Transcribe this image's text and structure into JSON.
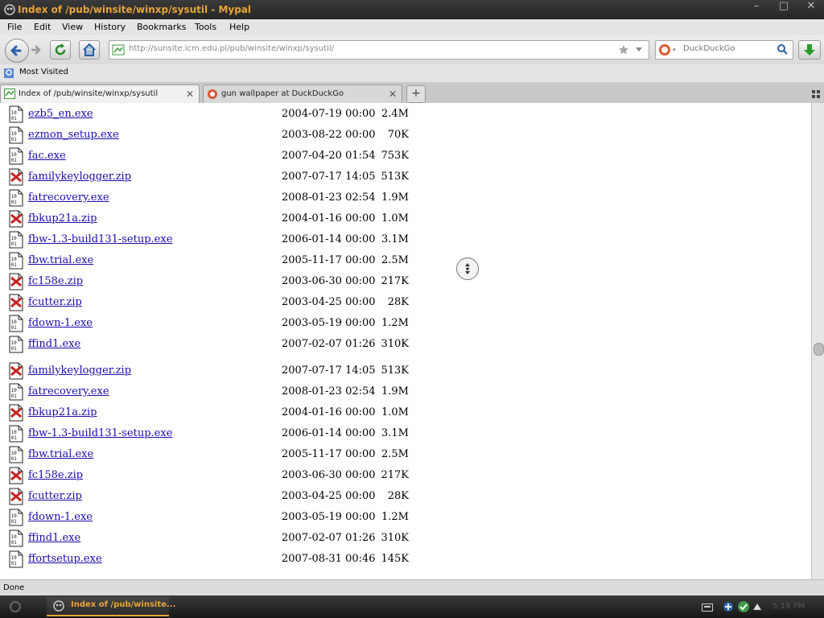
{
  "window": {
    "title": "Index of /pub/winsite/winxp/sysutil - Mypal",
    "controls": [
      "–",
      "□",
      "✕"
    ]
  },
  "menu": [
    "File",
    "Edit",
    "View",
    "History",
    "Bookmarks",
    "Tools",
    "Help"
  ],
  "nav": {
    "url": "http://sunsite.icm.edu.pl/pub/winsite/winxp/sysutil/",
    "search_placeholder": "DuckDuckGo"
  },
  "bookmarks": {
    "most_visited": "Most Visited"
  },
  "tabs": [
    {
      "label": "Index of /pub/winsite/winxp/sysutil",
      "close": "✕",
      "active": true
    },
    {
      "label": "gun wallpaper at DuckDuckGo",
      "close": "✕",
      "active": false
    }
  ],
  "tab_actions": {
    "new_tab": "+"
  },
  "files": [
    {
      "name": "ezb5_en.exe",
      "date": "2004-07-19 00:00",
      "size": "2.4M",
      "type": "exe"
    },
    {
      "name": "ezmon_setup.exe",
      "date": "2003-08-22 00:00",
      "size": "70K",
      "type": "exe"
    },
    {
      "name": "fac.exe",
      "date": "2007-04-20 01:54",
      "size": "753K",
      "type": "exe"
    },
    {
      "name": "familykeylogger.zip",
      "date": "2007-07-17 14:05",
      "size": "513K",
      "type": "zip"
    },
    {
      "name": "fatrecovery.exe",
      "date": "2008-01-23 02:54",
      "size": "1.9M",
      "type": "exe"
    },
    {
      "name": "fbkup21a.zip",
      "date": "2004-01-16 00:00",
      "size": "1.0M",
      "type": "zip"
    },
    {
      "name": "fbw-1.3-build131-setup.exe",
      "date": "2006-01-14 00:00",
      "size": "3.1M",
      "type": "exe"
    },
    {
      "name": "fbw.trial.exe",
      "date": "2005-11-17 00:00",
      "size": "2.5M",
      "type": "exe"
    },
    {
      "name": "fc158e.zip",
      "date": "2003-06-30 00:00",
      "size": "217K",
      "type": "zip"
    },
    {
      "name": "fcutter.zip",
      "date": "2003-04-25 00:00",
      "size": "28K",
      "type": "zip"
    },
    {
      "name": "fdown-1.exe",
      "date": "2003-05-19 00:00",
      "size": "1.2M",
      "type": "exe"
    },
    {
      "name": "ffind1.exe",
      "date": "2007-02-07 01:26",
      "size": "310K",
      "type": "exe"
    },
    {
      "name": "familykeylogger.zip",
      "date": "2007-07-17 14:05",
      "size": "513K",
      "type": "zip"
    },
    {
      "name": "fatrecovery.exe",
      "date": "2008-01-23 02:54",
      "size": "1.9M",
      "type": "exe"
    },
    {
      "name": "fbkup21a.zip",
      "date": "2004-01-16 00:00",
      "size": "1.0M",
      "type": "zip"
    },
    {
      "name": "fbw-1.3-build131-setup.exe",
      "date": "2006-01-14 00:00",
      "size": "3.1M",
      "type": "exe"
    },
    {
      "name": "fbw.trial.exe",
      "date": "2005-11-17 00:00",
      "size": "2.5M",
      "type": "exe"
    },
    {
      "name": "fc158e.zip",
      "date": "2003-06-30 00:00",
      "size": "217K",
      "type": "zip"
    },
    {
      "name": "fcutter.zip",
      "date": "2003-04-25 00:00",
      "size": "28K",
      "type": "zip"
    },
    {
      "name": "fdown-1.exe",
      "date": "2003-05-19 00:00",
      "size": "1.2M",
      "type": "exe"
    },
    {
      "name": "ffind1.exe",
      "date": "2007-02-07 01:26",
      "size": "310K",
      "type": "exe"
    },
    {
      "name": "ffortsetup.exe",
      "date": "2007-08-31 00:46",
      "size": "145K",
      "type": "exe"
    }
  ],
  "status": {
    "text": "Done"
  },
  "taskbar": {
    "task_label": "Index of /pub/winsite...",
    "clock": "5:19 PM"
  },
  "colors": {
    "accent": "#e8a33a",
    "link": "#1a0dab"
  }
}
